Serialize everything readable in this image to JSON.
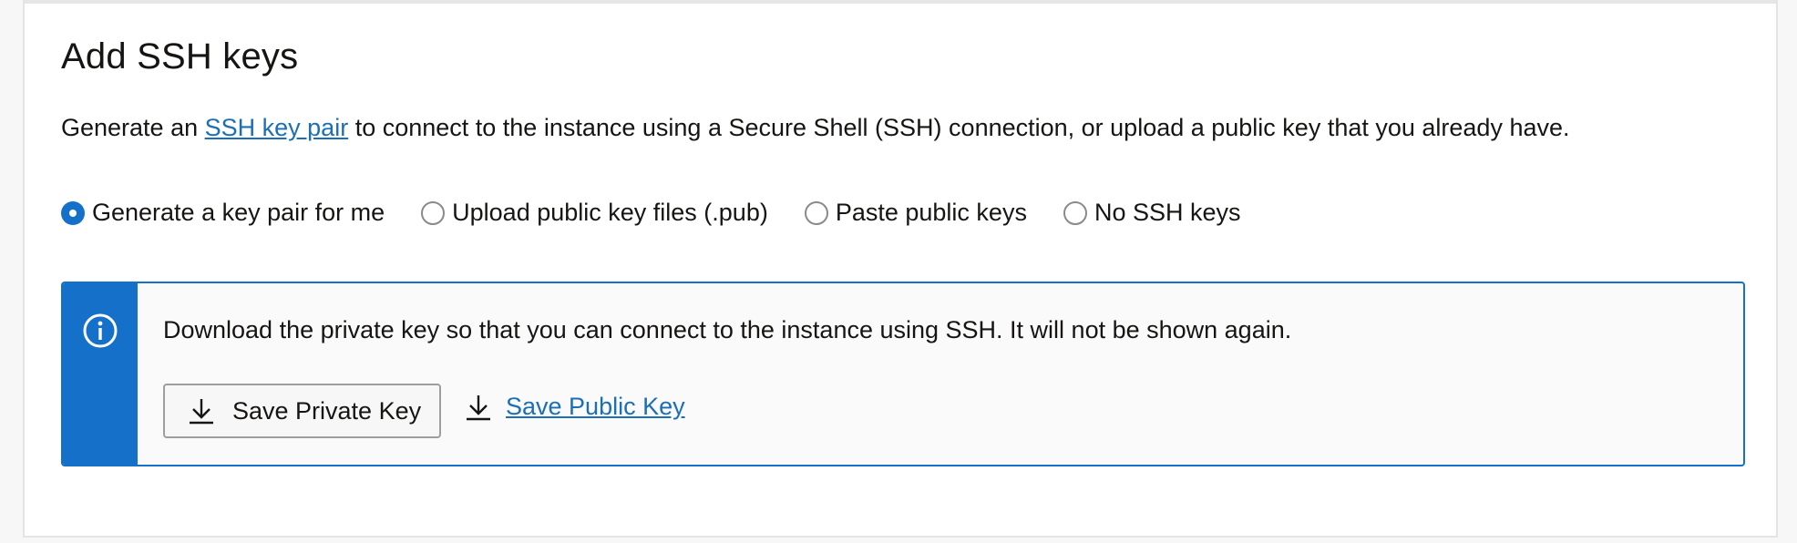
{
  "section": {
    "title": "Add SSH keys",
    "description_before": "Generate an ",
    "description_link": "SSH key pair",
    "description_after": " to connect to the instance using a Secure Shell (SSH) connection, or upload a public key that you already have."
  },
  "radio_options": [
    {
      "label": "Generate a key pair for me",
      "selected": true
    },
    {
      "label": "Upload public key files (.pub)",
      "selected": false
    },
    {
      "label": "Paste public keys",
      "selected": false
    },
    {
      "label": "No SSH keys",
      "selected": false
    }
  ],
  "info": {
    "icon": "info-icon",
    "message": "Download the private key so that you can connect to the instance using SSH. It will not be shown again.",
    "save_private_label": "Save Private Key",
    "save_public_label": "Save Public Key"
  },
  "colors": {
    "accent": "#1570c9",
    "link": "#1a6fb8"
  }
}
